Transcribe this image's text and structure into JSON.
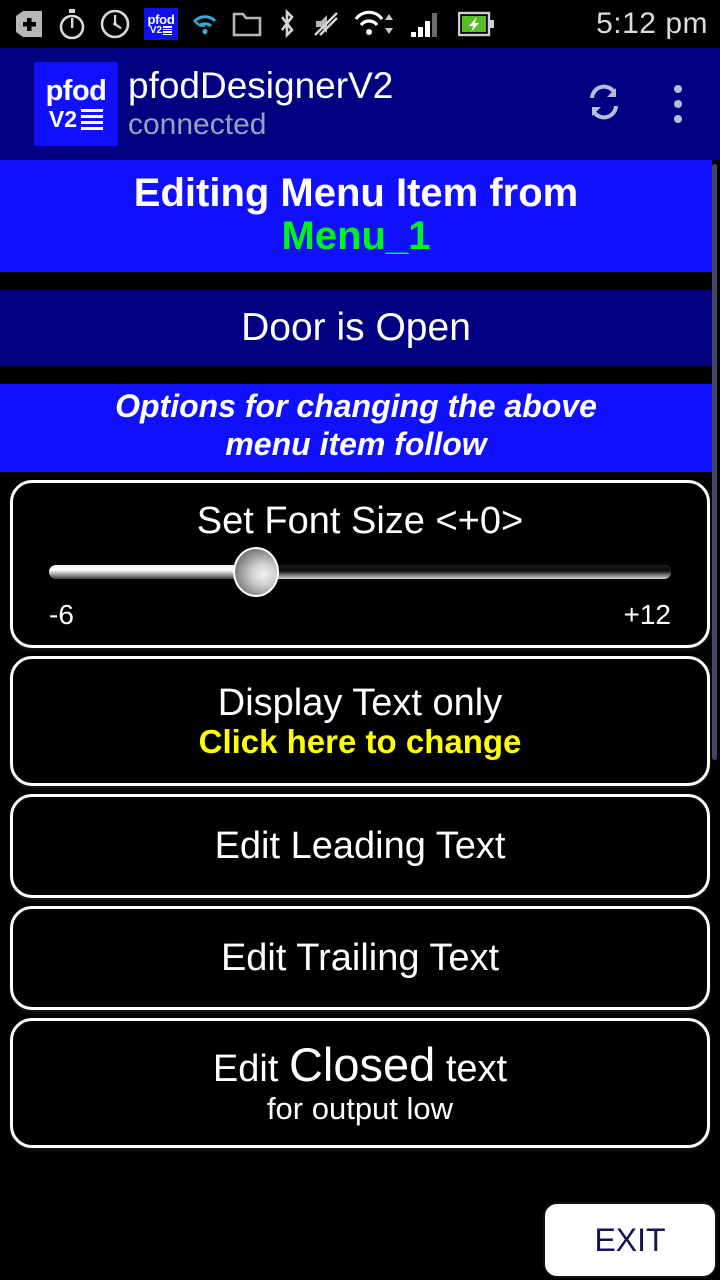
{
  "status_bar": {
    "icons": [
      {
        "name": "add-plus-icon"
      },
      {
        "name": "stopwatch-icon"
      },
      {
        "name": "clock-icon"
      },
      {
        "name": "pfod-app-icon",
        "line1": "pfod",
        "line2": "V2"
      },
      {
        "name": "wifi-small-icon"
      },
      {
        "name": "folder-icon"
      },
      {
        "name": "bluetooth-icon"
      },
      {
        "name": "mute-icon"
      },
      {
        "name": "wifi-transfer-icon"
      },
      {
        "name": "cellular-signal-icon"
      },
      {
        "name": "battery-charging-icon"
      }
    ],
    "time": "5:12 pm"
  },
  "app_bar": {
    "logo": {
      "line1": "pfod",
      "line2": "V2"
    },
    "title": "pfodDesignerV2",
    "subtitle": "connected",
    "refresh_icon": "refresh-icon",
    "overflow_icon": "overflow-menu-icon"
  },
  "banner_editing": {
    "line1": "Editing Menu Item from",
    "line2": "Menu_1"
  },
  "menu_item_preview": {
    "text": "Door is Open"
  },
  "banner_options": {
    "line1": "Options for changing the above",
    "line2": "menu item follow"
  },
  "font_size_slider": {
    "title": "Set Font Size <+0>",
    "min_label": "-6",
    "max_label": "+12",
    "min": -6,
    "max": 12,
    "value": 0,
    "percent": 33.3
  },
  "options": [
    {
      "id": "display-text-only",
      "main": "Display Text only",
      "sub": "Click here to change",
      "sub_color": "#ffff00"
    },
    {
      "id": "edit-leading-text",
      "main": "Edit Leading Text"
    },
    {
      "id": "edit-trailing-text",
      "main": "Edit Trailing Text"
    },
    {
      "id": "edit-closed-text",
      "main_pre": "Edit ",
      "main_big": "Closed",
      "main_post": " text",
      "sub": "for output low"
    }
  ],
  "exit_button": {
    "label": "EXIT"
  },
  "colors": {
    "app_bar_navy": "#000080",
    "bright_blue": "#1010ff",
    "accent_green": "#00f41a",
    "accent_yellow": "#ffff00",
    "black": "#000000",
    "white": "#ffffff",
    "exit_text": "#141450"
  }
}
